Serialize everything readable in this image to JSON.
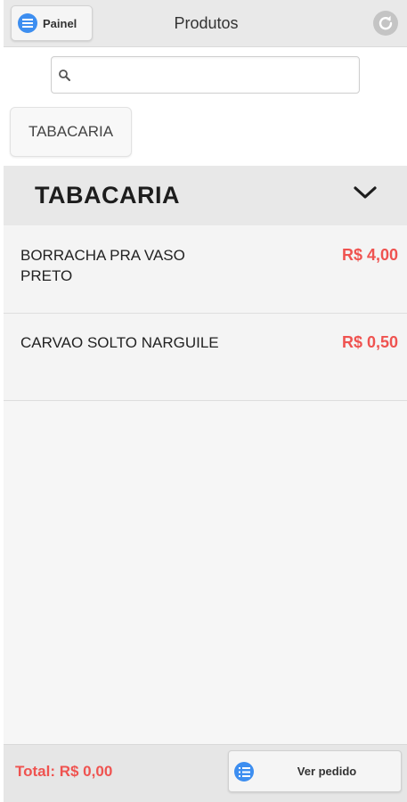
{
  "header": {
    "painel_label": "Painel",
    "title": "Produtos"
  },
  "search": {
    "placeholder": "",
    "value": ""
  },
  "categories": [
    {
      "label": "TABACARIA"
    }
  ],
  "section": {
    "title": "TABACARIA"
  },
  "products": [
    {
      "name": "BORRACHA PRA VASO PRETO",
      "price": "R$ 4,00"
    },
    {
      "name": "CARVAO SOLTO NARGUILE",
      "price": "R$ 0,50"
    }
  ],
  "footer": {
    "total": "Total: R$ 0,00",
    "view_order_label": "Ver pedido"
  },
  "icons": {
    "painel": "menu-icon",
    "refresh": "refresh-icon",
    "search": "search-icon",
    "section_toggle": "chevron-down-icon",
    "view_order": "list-icon"
  },
  "colors": {
    "accent_blue": "#3d8ef0",
    "price_red": "#ef5350",
    "header_bg": "#e9e9e9"
  }
}
